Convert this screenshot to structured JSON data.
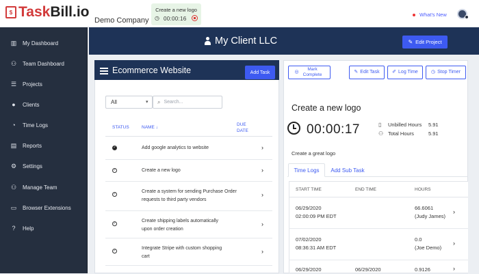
{
  "app": {
    "logo_text_1": "Task",
    "logo_text_2": "Bill.io",
    "logo_mark": "$",
    "company": "Demo Company",
    "whats_new": "What's New"
  },
  "timer_widget": {
    "title": "Create a new logo",
    "time": "00:00:16"
  },
  "sidebar": {
    "items": [
      {
        "label": "My Dashboard",
        "icon": "columns-icon"
      },
      {
        "label": "Team Dashboard",
        "icon": "team-icon"
      },
      {
        "label": "Projects",
        "icon": "tasks-icon"
      },
      {
        "label": "Clients",
        "icon": "user-icon"
      },
      {
        "label": "Time Logs",
        "icon": "user-clock-icon"
      },
      {
        "label": "Reports",
        "icon": "document-icon"
      },
      {
        "label": "Settings",
        "icon": "gear-icon"
      },
      {
        "label": "Manage Team",
        "icon": "users-cog-icon"
      },
      {
        "label": "Browser Extensions",
        "icon": "window-icon"
      },
      {
        "label": "Help",
        "icon": "question-icon"
      }
    ]
  },
  "header": {
    "client": "My Client LLC",
    "edit_project": "Edit Project"
  },
  "project": {
    "title": "Ecommerce Website",
    "add_task": "Add Task",
    "filter_value": "All",
    "search_placeholder": "Search...",
    "columns": {
      "status": "STATUS",
      "name": "NAME ↓",
      "due": "DUE\nDATE"
    },
    "tasks": [
      {
        "name": "Add google analytics to website",
        "done": true
      },
      {
        "name": "Create a new logo",
        "done": false
      },
      {
        "name": "Create a system for sending Purchase Order requests to third party vendors",
        "done": false
      },
      {
        "name": "Create shipping labels automatically upon order creation",
        "done": false
      },
      {
        "name": "Integrate Stripe with custom shopping cart",
        "done": false
      }
    ]
  },
  "task_panel": {
    "buttons": {
      "mark_complete": "Mark Complete",
      "edit_task": "Edit Task",
      "log_time": "Log Time",
      "stop_timer": "Stop Timer"
    },
    "title": "Create a new logo",
    "timer": "00:00:17",
    "unbilled_label": "Unbilled Hours",
    "unbilled_value": "5.91",
    "total_label": "Total Hours",
    "total_value": "5.91",
    "description": "Create a great logo",
    "tabs": [
      "Time Logs",
      "Add Sub Task"
    ],
    "log_columns": {
      "start": "START TIME",
      "end": "END TIME",
      "hours": "HOURS"
    },
    "logs": [
      {
        "start_date": "06/29/2020",
        "start_time": "02:00:09 PM EDT",
        "end_date": "",
        "end_time": "",
        "hours": "66.6061",
        "who": "(Judy James)"
      },
      {
        "start_date": "07/02/2020",
        "start_time": "08:36:31 AM EDT",
        "end_date": "",
        "end_time": "",
        "hours": "0.0",
        "who": "(Joe Demo)"
      },
      {
        "start_date": "06/29/2020",
        "start_time": "",
        "end_date": "06/29/2020",
        "end_time": "",
        "hours": "0.9126",
        "who": ""
      }
    ]
  }
}
